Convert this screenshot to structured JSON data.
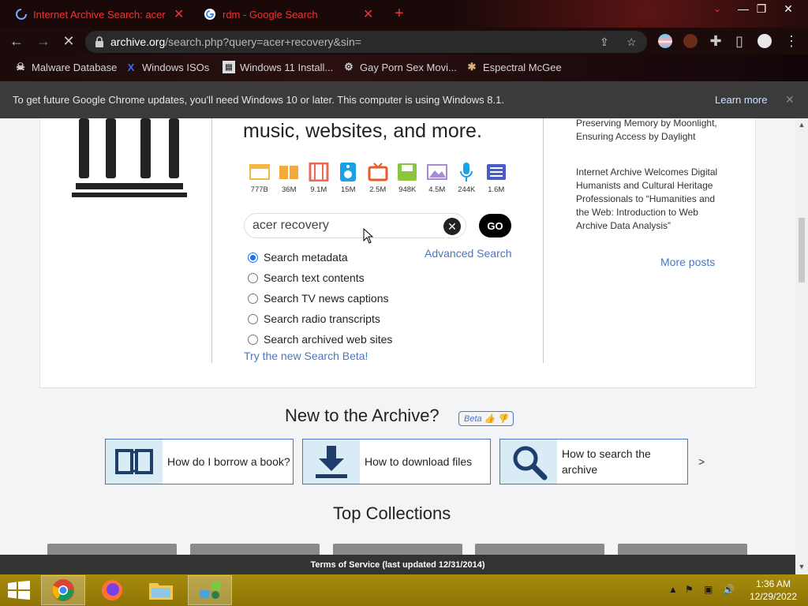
{
  "browser": {
    "tabs": [
      {
        "label": "Internet Archive Search: acer",
        "active": true
      },
      {
        "label": "rdm - Google Search",
        "active": false
      }
    ],
    "url_host": "archive.org",
    "url_path": "/search.php?query=acer+recovery&sin=",
    "bookmarks": [
      {
        "label": "Malware Database",
        "icon": "skull-icon"
      },
      {
        "label": "Windows ISOs",
        "icon": "x-icon"
      },
      {
        "label": "Windows 11 Install...",
        "icon": "page-icon"
      },
      {
        "label": "Gay Porn Sex Movi...",
        "icon": "gear-icon"
      },
      {
        "label": "Espectral McGee",
        "icon": "creature-icon"
      }
    ],
    "infobar": {
      "message": "To get future Google Chrome updates, you'll need Windows 10 or later. This computer is using Windows 8.1.",
      "action": "Learn more"
    }
  },
  "page": {
    "headline": "music, websites, and more.",
    "media": [
      {
        "icon": "web-icon",
        "count": "777B",
        "color": "#f3b843"
      },
      {
        "icon": "book-icon",
        "count": "36M",
        "color": "#f3a93b"
      },
      {
        "icon": "film-icon",
        "count": "9.1M",
        "color": "#ea6a58"
      },
      {
        "icon": "audio-icon",
        "count": "15M",
        "color": "#19a0e6"
      },
      {
        "icon": "tv-icon",
        "count": "2.5M",
        "color": "#e8582a"
      },
      {
        "icon": "software-icon",
        "count": "948K",
        "color": "#8cc63f"
      },
      {
        "icon": "image-icon",
        "count": "4.5M",
        "color": "#a78bd6"
      },
      {
        "icon": "mic-icon",
        "count": "244K",
        "color": "#1aa2e6"
      },
      {
        "icon": "list-icon",
        "count": "1.6M",
        "color": "#4a5cc7"
      }
    ],
    "search": {
      "value": "acer recovery",
      "go_label": "GO",
      "advanced_label": "Advanced Search",
      "options": [
        {
          "label": "Search metadata",
          "checked": true
        },
        {
          "label": "Search text contents",
          "checked": false
        },
        {
          "label": "Search TV news captions",
          "checked": false
        },
        {
          "label": "Search radio transcripts",
          "checked": false
        },
        {
          "label": "Search archived web sites",
          "checked": false
        }
      ],
      "beta_link": "Try the new Search Beta!"
    },
    "sidebar_posts": [
      "Preserving Memory by Moonlight, Ensuring Access by Daylight",
      "Internet Archive Welcomes Digital Humanists and Cultural Heritage Professionals to “Humanities and the Web: Introduction to Web Archive Data Analysis”"
    ],
    "more_posts": "More posts",
    "new_to_archive": {
      "title": "New to the Archive?",
      "beta_tag": "Beta",
      "cards": [
        {
          "label": "How do I borrow a book?",
          "icon": "open-book-icon"
        },
        {
          "label": "How to download files",
          "icon": "download-icon"
        },
        {
          "label": "How to search the archive",
          "icon": "magnifier-icon"
        }
      ],
      "next": ">"
    },
    "top_collections_title": "Top Collections",
    "tos": "Terms of Service (last updated 12/31/2014)"
  },
  "taskbar": {
    "apps": [
      "chrome-icon",
      "firefox-icon",
      "file-explorer-icon",
      "network-app-icon"
    ],
    "time": "1:36 AM",
    "date": "12/29/2022"
  },
  "colors": {
    "link": "#4a76c1",
    "taskbar": "#9c7f08",
    "tab_text": "#e33333"
  }
}
